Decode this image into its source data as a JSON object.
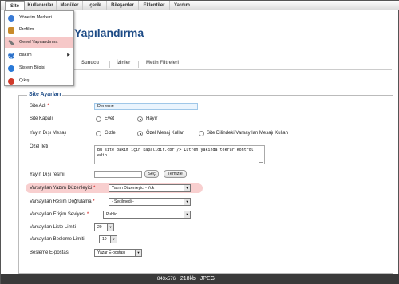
{
  "menubar": {
    "items": [
      "Site",
      "Kullanıcılar",
      "Menüler",
      "İçerik",
      "Bileşenler",
      "Eklentiler",
      "Yardım"
    ]
  },
  "dropdown": {
    "items": [
      {
        "label": "Yönetim Merkezi",
        "icon": "control-panel-icon",
        "color": "#3a7bd5"
      },
      {
        "label": "Profilim",
        "icon": "user-profile-icon",
        "color": "#c88a2a"
      },
      {
        "label": "Genel Yapılandırma",
        "icon": "wrench-icon",
        "color": "#777777"
      },
      {
        "label": "Bakım",
        "icon": "gear-icon",
        "color": "#2a6fc8"
      },
      {
        "label": "Sistem Bilgisi",
        "icon": "info-icon",
        "color": "#2a7ad8"
      },
      {
        "label": "Çıkış",
        "icon": "logout-icon",
        "color": "#d03a2a"
      }
    ],
    "submenu_arrow": "▶"
  },
  "page": {
    "title": "Yapılandırma"
  },
  "tabs": [
    "Sunucu",
    "İzinler",
    "Metin Filtreleri"
  ],
  "form": {
    "legend": "Site Ayarları",
    "site_name": {
      "label": "Site Adı",
      "required": "*",
      "value": "Deneme"
    },
    "site_offline": {
      "label": "Site Kapalı",
      "opt_yes": "Evet",
      "opt_no": "Hayır"
    },
    "offline_message": {
      "label": "Yayın Dışı Mesajı",
      "opt_hide": "Gizle",
      "opt_custom": "Özel Mesaj Kullan",
      "opt_default": "Site Dilindeki Varsayılan Mesajı Kullan"
    },
    "custom_message": {
      "label": "Özel İleti",
      "value": "Bu site bakım için kapalıdır.<br /> Lütfen yakında tekrar kontrol edin."
    },
    "offline_image": {
      "label": "Yayın Dışı resmi",
      "select_btn": "Seç",
      "clear_btn": "Temizle"
    },
    "default_editor": {
      "label": "Varsayılan Yazım Düzenleyici",
      "required": "*",
      "value": "Yazım Düzenleyici - Yok"
    },
    "default_captcha": {
      "label": "Varsayılan Resim Doğrulama",
      "required": "*",
      "value": "- Seçilmedi -"
    },
    "default_access": {
      "label": "Varsayılan Erişim Seviyesi",
      "required": "*",
      "value": "Public"
    },
    "list_limit": {
      "label": "Varsayılan Liste Limiti",
      "value": "20"
    },
    "feed_limit": {
      "label": "Varsayılan Besleme Limiti",
      "value": "10"
    },
    "feed_email": {
      "label": "Besleme E-postası",
      "value": "Yazar E-postası"
    }
  },
  "footer": {
    "dims": "843x576",
    "size": "218kb",
    "format": "JPEG"
  },
  "colors": {
    "accent": "#1d4b86",
    "highlight": "#f8cfcf",
    "input_bg": "#eaf4fd"
  }
}
